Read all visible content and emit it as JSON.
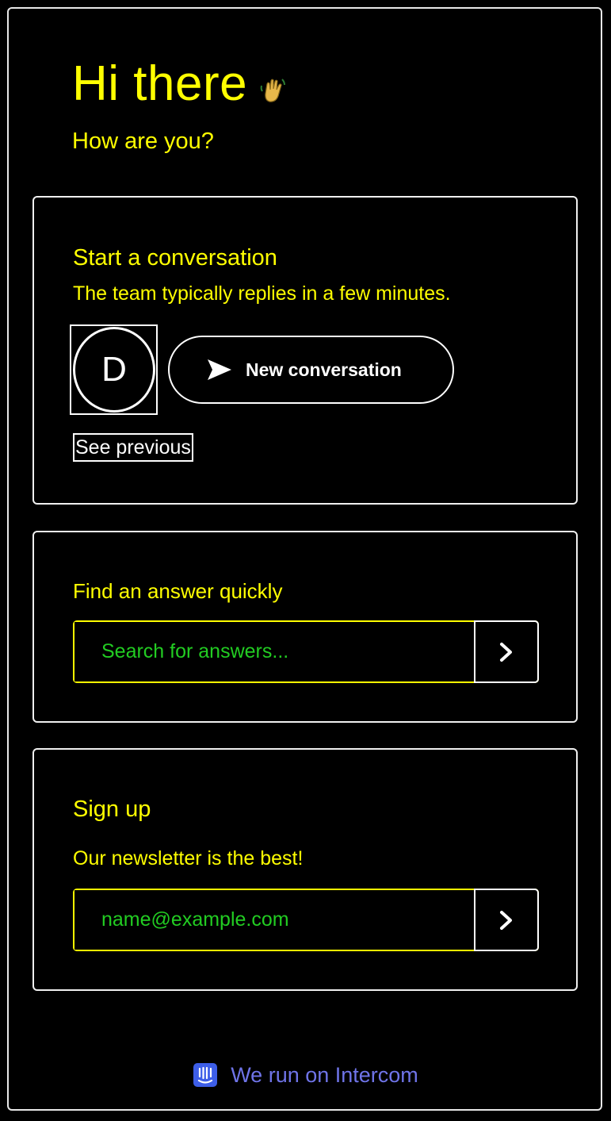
{
  "header": {
    "greeting": "Hi there",
    "wave_icon": "waving-hand-icon",
    "subgreeting": "How are you?"
  },
  "conversation_card": {
    "title": "Start a conversation",
    "reply_time": "The team typically replies in a few minutes.",
    "avatar_initial": "D",
    "new_conversation_label": "New conversation",
    "send_icon": "send-arrow-icon",
    "see_previous_label": "See previous"
  },
  "search_card": {
    "title": "Find an answer quickly",
    "placeholder": "Search for answers...",
    "submit_icon": "chevron-right-icon"
  },
  "signup_card": {
    "title": "Sign up",
    "description": "Our newsletter is the best!",
    "placeholder": "name@example.com",
    "submit_icon": "chevron-right-icon"
  },
  "footer": {
    "text": "We run on Intercom",
    "icon": "intercom-logo-icon"
  },
  "colors": {
    "background": "#000000",
    "heading": "#ffff00",
    "input_text": "#22cc22",
    "footer_link": "#6f74e8",
    "border": "#ffffff"
  }
}
